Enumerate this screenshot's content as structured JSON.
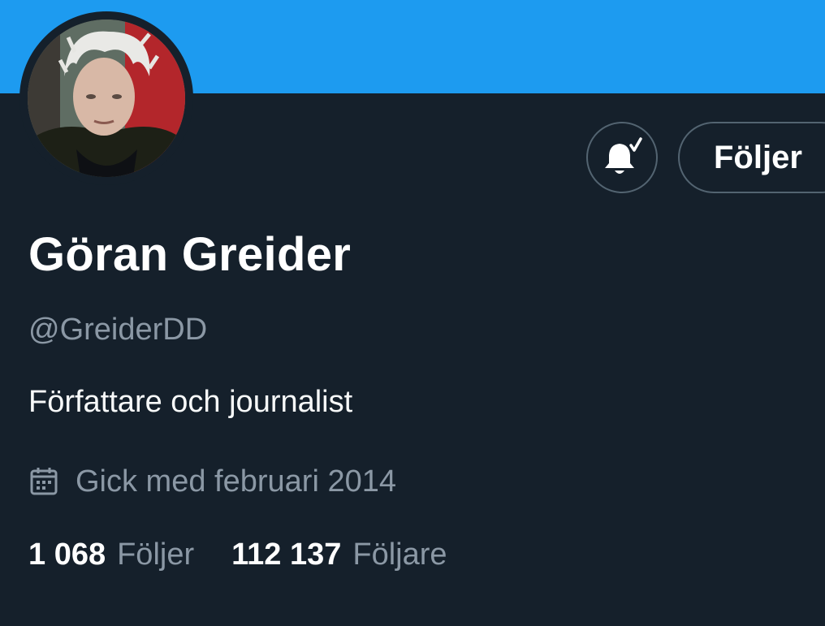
{
  "profile": {
    "display_name": "Göran Greider",
    "handle": "@GreiderDD",
    "bio": "Författare och journalist",
    "joined": "Gick med februari 2014"
  },
  "actions": {
    "follow_label": "Följer",
    "bell_icon": "bell-check-icon"
  },
  "stats": {
    "following_count": "1 068",
    "following_label": "Följer",
    "followers_count": "112 137",
    "followers_label": "Följare"
  },
  "colors": {
    "banner": "#1d9bf0",
    "background": "#15202b",
    "secondary_text": "#8b98a5",
    "border": "#536471"
  },
  "icons": {
    "joined": "calendar-icon"
  }
}
